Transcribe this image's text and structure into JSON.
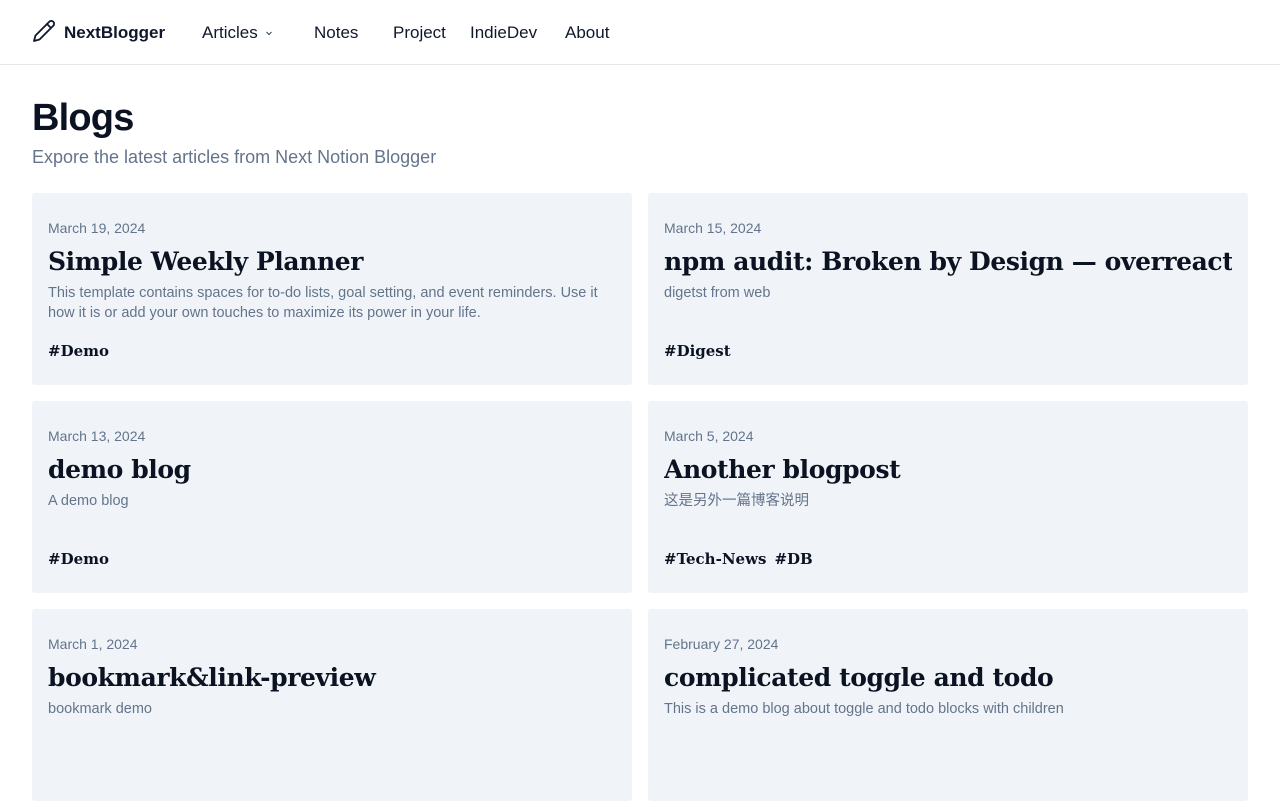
{
  "brand": {
    "name": "NextBlogger",
    "icon": "pencil-icon"
  },
  "nav": {
    "articles": "Articles",
    "notes": "Notes",
    "project": "Project",
    "indiedev": "IndieDev",
    "about": "About"
  },
  "page": {
    "title": "Blogs",
    "subtitle": "Expore the latest articles from Next Notion Blogger"
  },
  "posts": [
    {
      "date": "March 19, 2024",
      "title": "Simple Weekly Planner",
      "description": "This template contains spaces for to-do lists, goal setting, and event reminders. Use it how it is or add your own touches to maximize its power in your life.",
      "tags": [
        "#Demo"
      ]
    },
    {
      "date": "March 15, 2024",
      "title": "npm audit: Broken by Design — overreacted",
      "description": "digetst from web",
      "tags": [
        "#Digest"
      ]
    },
    {
      "date": "March 13, 2024",
      "title": "demo blog",
      "description": "A demo blog",
      "tags": [
        "#Demo"
      ]
    },
    {
      "date": "March 5, 2024",
      "title": "Another blogpost",
      "description": "这是另外一篇博客说明",
      "tags": [
        "#Tech-News",
        "#DB"
      ]
    },
    {
      "date": "March 1, 2024",
      "title": "bookmark&link-preview",
      "description": "bookmark demo",
      "tags": []
    },
    {
      "date": "February 27, 2024",
      "title": "complicated toggle and todo",
      "description": "This is a demo blog about toggle and todo blocks with children",
      "tags": []
    }
  ],
  "colors": {
    "card_background": "#f0f4f8",
    "muted_text": "#64748b",
    "heading_text": "#0b1222"
  }
}
